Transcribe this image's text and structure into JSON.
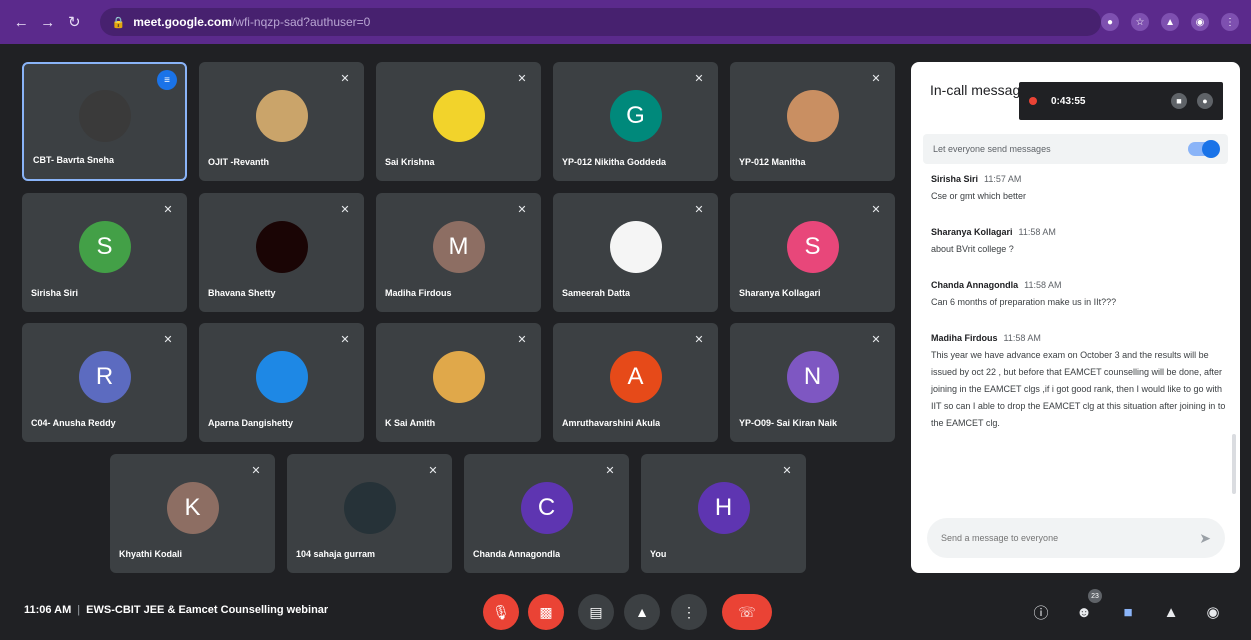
{
  "browser": {
    "url_host": "meet.google.com",
    "url_path": "/wfi-nqzp-sad?authuser=0"
  },
  "tiles_row1": [
    {
      "name": "CBT- Bavrta Sneha",
      "avatar": "photo",
      "color": "#3a3a3a",
      "speaking": true
    },
    {
      "name": "OJIT -Revanth",
      "avatar": "photo",
      "color": "#caa46a"
    },
    {
      "name": "Sai Krishna",
      "avatar": "photo",
      "color": "#f2d32b"
    },
    {
      "name": "YP-012 Nikitha Goddeda",
      "avatar": "G",
      "color": "#00897b"
    },
    {
      "name": "YP-012 Manitha",
      "avatar": "photo",
      "color": "#c98f62"
    }
  ],
  "tiles_row2": [
    {
      "name": "Sirisha Siri",
      "avatar": "S",
      "color": "#43a047"
    },
    {
      "name": "Bhavana Shetty",
      "avatar": "photo",
      "color": "#1a0505"
    },
    {
      "name": "Madiha Firdous",
      "avatar": "M",
      "color": "#8d6e63"
    },
    {
      "name": "Sameerah Datta",
      "avatar": "photo",
      "color": "#f5f5f5"
    },
    {
      "name": "Sharanya Kollagari",
      "avatar": "S",
      "color": "#e8477a"
    }
  ],
  "tiles_row3": [
    {
      "name": "C04- Anusha Reddy",
      "avatar": "R",
      "color": "#5c6bc0"
    },
    {
      "name": "Aparna Dangishetty",
      "avatar": "photo",
      "color": "#1e88e5"
    },
    {
      "name": "K Sai Amith",
      "avatar": "photo",
      "color": "#e0a84a"
    },
    {
      "name": "Amruthavarshini Akula",
      "avatar": "A",
      "color": "#e64a19"
    },
    {
      "name": "YP-O09- Sai Kiran Naik",
      "avatar": "N",
      "color": "#7e57c2"
    }
  ],
  "tiles_row4": [
    {
      "name": "Khyathi Kodali",
      "avatar": "K",
      "color": "#8d6e63"
    },
    {
      "name": "104 sahaja gurram",
      "avatar": "photo",
      "color": "#263238"
    },
    {
      "name": "Chanda Annagondla",
      "avatar": "C",
      "color": "#5e35b1"
    },
    {
      "name": "You",
      "avatar": "H",
      "color": "#5e35b1"
    }
  ],
  "chat": {
    "title": "In-call messages",
    "recording_time": "0:43:55",
    "toggle_label": "Let everyone send messages",
    "messages": [
      {
        "author": "Sirisha Siri",
        "time": "11:57 AM",
        "text": "Cse or gmt which better"
      },
      {
        "author": "Sharanya Kollagari",
        "time": "11:58 AM",
        "text": "about BVrit college ?"
      },
      {
        "author": "Chanda Annagondla",
        "time": "11:58 AM",
        "text": "Can 6 months of preparation make us in IIt???"
      },
      {
        "author": "Madiha Firdous",
        "time": "11:58 AM",
        "text": "This year we have advance exam on October 3 and the results will be issued by oct 22 , but before that EAMCET counselling will be done, after joining in the EAMCET clgs ,if i got good rank, then I would like to go with IIT so can I able to drop the EAMCET clg at this situation after joining in to the EAMCET clg."
      }
    ],
    "compose_placeholder": "Send a message to everyone"
  },
  "bottom": {
    "time": "11:06 AM",
    "meeting_title": "EWS-CBIT JEE & Eamcet Counselling webinar",
    "people_count": "23"
  }
}
